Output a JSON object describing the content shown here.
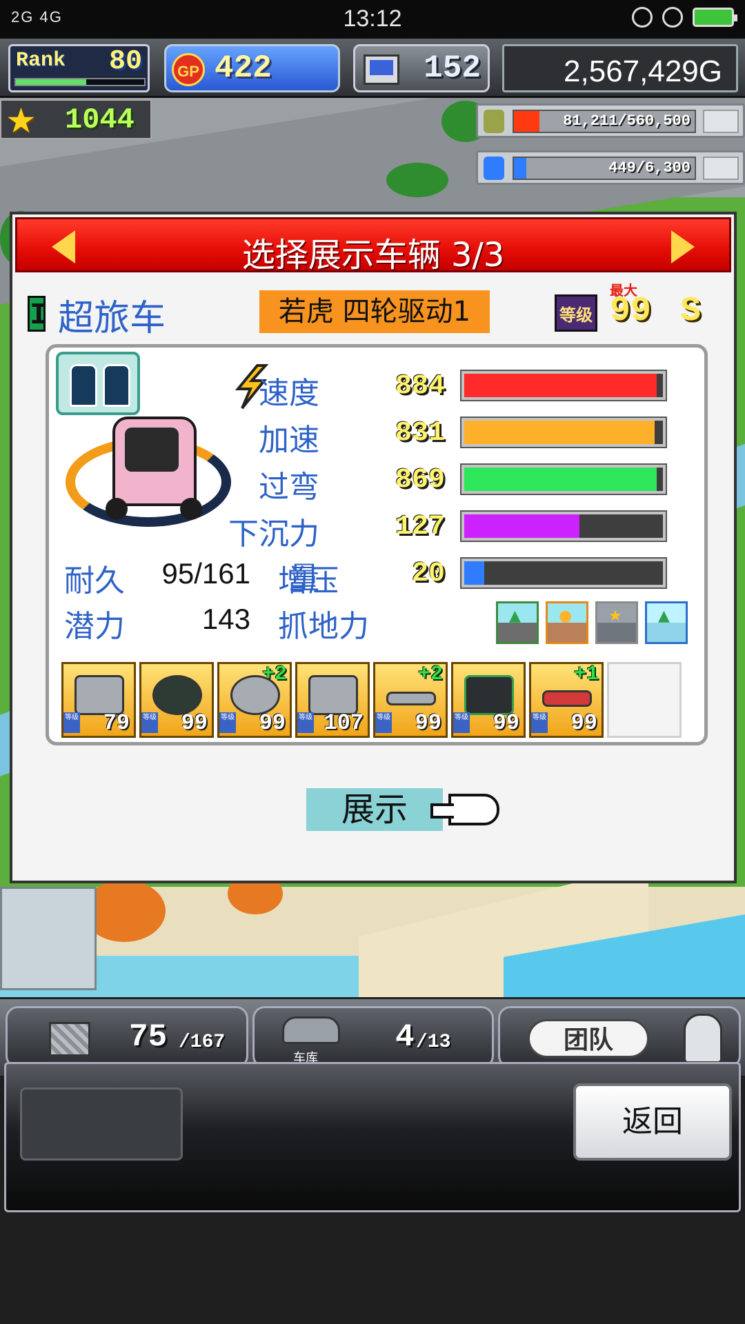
{
  "status_bar": {
    "signal": "2G 4G",
    "time": "13:12"
  },
  "hud": {
    "rank_label": "Rank",
    "rank_value": "80",
    "rank_progress": 0.55,
    "gp_label": "GP",
    "gp_value": "422",
    "pc_value": "152",
    "money": "2,567,429G",
    "star_value": "1044"
  },
  "resources": [
    {
      "text": "81,211/560,500",
      "fill": 0.14,
      "color": "#ff3a10"
    },
    {
      "text": "449/6,300",
      "fill": 0.07,
      "color": "#2f7cff"
    }
  ],
  "dialog": {
    "title": "选择展示车辆 3/3",
    "class_letter": "I",
    "car_type": "超旅车",
    "car_name": "若虎 四轮驱动1",
    "level_label": "等级",
    "max_label": "最大",
    "level_value": "99",
    "grade": "S",
    "stats": [
      {
        "label": "速度",
        "value": "884",
        "fill": 0.97,
        "color": "#ff2a2a"
      },
      {
        "label": "加速",
        "value": "831",
        "fill": 0.96,
        "color": "#ffb02a"
      },
      {
        "label": "过弯",
        "value": "869",
        "fill": 0.97,
        "color": "#2ee65a"
      },
      {
        "label": "下沉力量",
        "value": "127",
        "fill": 0.58,
        "color": "#cc22ff"
      },
      {
        "label": "增压",
        "value": "20",
        "fill": 0.1,
        "color": "#2f7cff"
      }
    ],
    "durability_label": "耐久",
    "durability_value": "95/161",
    "potential_label": "潜力",
    "potential_value": "143",
    "grip_label": "抓地力",
    "parts": [
      {
        "bonus": "",
        "level": "79",
        "lv_tag": "等级"
      },
      {
        "bonus": "",
        "level": "99",
        "lv_tag": "等级"
      },
      {
        "bonus": "+2",
        "level": "99",
        "lv_tag": "等级"
      },
      {
        "bonus": "",
        "level": "107",
        "lv_tag": "等级"
      },
      {
        "bonus": "+2",
        "level": "99",
        "lv_tag": "等级"
      },
      {
        "bonus": "",
        "level": "99",
        "lv_tag": "等级"
      },
      {
        "bonus": "+1",
        "level": "99",
        "lv_tag": "等级"
      }
    ],
    "show_button": "展示"
  },
  "bottom": {
    "slot1_count": "75",
    "slot1_total": "/167",
    "slot2_label": "车库",
    "slot2_count": "4",
    "slot2_total": "/13",
    "team_label": "团队"
  },
  "back_button": "返回"
}
